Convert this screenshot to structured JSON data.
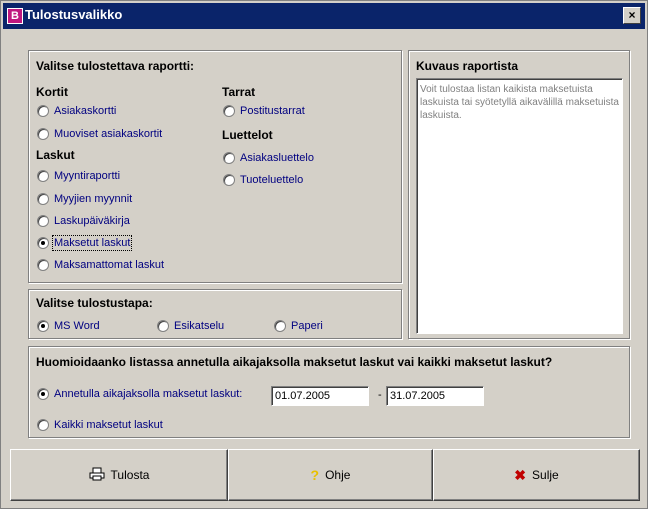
{
  "window": {
    "title": "Tulostusvalikko",
    "app_icon_glyph": "B",
    "close_glyph": "×"
  },
  "report_group": {
    "title": "Valitse tulostettava raportti:",
    "kortit": {
      "heading": "Kortit",
      "items": [
        {
          "label": "Asiakaskortti",
          "selected": false
        },
        {
          "label": "Muoviset asiakaskortit",
          "selected": false
        }
      ]
    },
    "laskut": {
      "heading": "Laskut",
      "items": [
        {
          "label": "Myyntiraportti",
          "selected": false
        },
        {
          "label": "Myyjien myynnit",
          "selected": false
        },
        {
          "label": "Laskupäiväkirja",
          "selected": false
        },
        {
          "label": "Maksetut laskut",
          "selected": true
        },
        {
          "label": "Maksamattomat laskut",
          "selected": false
        }
      ]
    },
    "tarrat": {
      "heading": "Tarrat",
      "items": [
        {
          "label": "Postitustarrat",
          "selected": false
        }
      ]
    },
    "luettelot": {
      "heading": "Luettelot",
      "items": [
        {
          "label": "Asiakasluettelo",
          "selected": false
        },
        {
          "label": "Tuoteluettelo",
          "selected": false
        }
      ]
    }
  },
  "output_group": {
    "title": "Valitse tulostustapa:",
    "options": [
      {
        "label": "MS Word",
        "selected": true
      },
      {
        "label": "Esikatselu",
        "selected": false
      },
      {
        "label": "Paperi",
        "selected": false
      }
    ]
  },
  "description": {
    "title": "Kuvaus raportista",
    "text": "Voit tulostaa listan kaikista maksetuista laskuista tai syötetyllä aikavälillä maksetuista laskuista."
  },
  "period_group": {
    "title": "Huomioidaanko listassa annetulla aikajaksolla maksetut laskut vai kaikki maksetut laskut?",
    "option_period": "Annetulla aikajaksolla maksetut laskut:",
    "option_period_selected": true,
    "start_date": "01.07.2005",
    "separator": "-",
    "end_date": "31.07.2005",
    "option_all": "Kaikki maksetut laskut",
    "option_all_selected": false
  },
  "buttons": {
    "print": {
      "label": "Tulosta",
      "icon": "printer-icon"
    },
    "help": {
      "label": "Ohje",
      "icon": "question-icon"
    },
    "close": {
      "label": "Sulje",
      "icon": "x-icon"
    }
  },
  "colors": {
    "titlebar": "#0a246a",
    "option_text": "#000080",
    "help_icon": "#e8c000",
    "close_icon": "#c00000"
  }
}
